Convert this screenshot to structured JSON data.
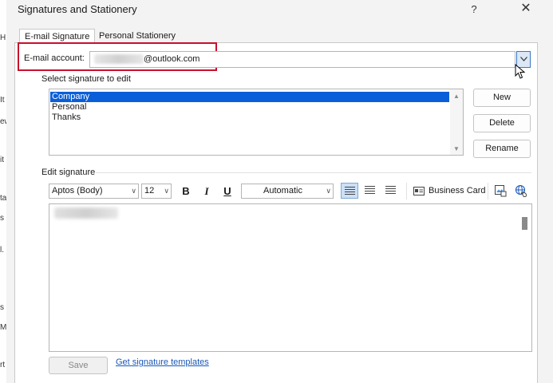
{
  "window": {
    "title": "Signatures and Stationery",
    "help_label": "?",
    "close_label": "✕"
  },
  "background_chars": [
    "H",
    "It",
    "ew",
    "it",
    "ta",
    "s",
    "l.",
    "s",
    "M",
    "rt"
  ],
  "tabs": [
    {
      "label": "E-mail Signature"
    },
    {
      "label": "Personal Stationery"
    }
  ],
  "account": {
    "label": "E-mail account:",
    "value": "@outlook.com",
    "dropdown_icon": "chevron-down-icon",
    "highlight_color": "#c8102e"
  },
  "select_signature": {
    "label": "Select signature to edit",
    "items": [
      "Company",
      "Personal",
      "Thanks"
    ],
    "selected_index": 0
  },
  "side_buttons": {
    "new": "New",
    "delete": "Delete",
    "rename": "Rename"
  },
  "edit_signature": {
    "label": "Edit signature",
    "font_name": "Aptos (Body)",
    "font_size": "12",
    "bold": "B",
    "italic": "I",
    "underline": "U",
    "color": "Automatic",
    "business_card": "Business Card"
  },
  "footer": {
    "save": "Save",
    "templates_link": "Get signature templates"
  },
  "colors": {
    "accent": "#0a5fd8",
    "link": "#1a58b8"
  }
}
